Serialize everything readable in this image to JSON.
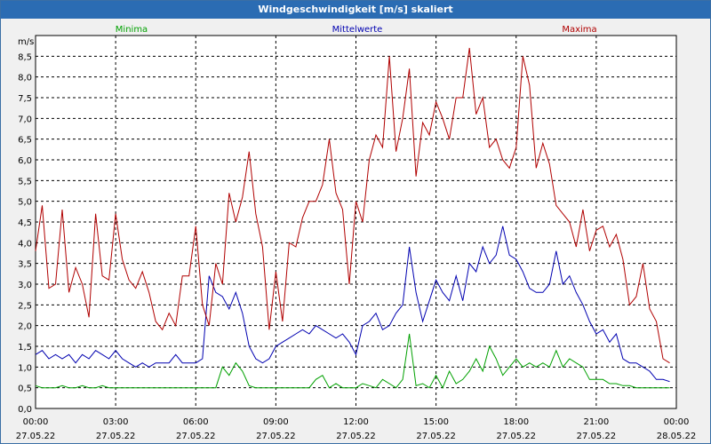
{
  "window": {
    "title": "Windgeschwindigkeit [m/s] skaliert"
  },
  "chart_data": {
    "type": "line",
    "ylabel": "m/s",
    "ylim": [
      0,
      9
    ],
    "xlim": [
      "27.05.22 00:00",
      "28.05.22 00:00"
    ],
    "grid": true,
    "legend_placement": "top",
    "y_ticks": [
      "0,0",
      "0,5",
      "1,0",
      "1,5",
      "2,0",
      "2,5",
      "3,0",
      "3,5",
      "4,0",
      "4,5",
      "5,0",
      "5,5",
      "6,0",
      "6,5",
      "7,0",
      "7,5",
      "8,0",
      "8,5"
    ],
    "x_ticks": [
      {
        "time": "00:00",
        "date": "27.05.22"
      },
      {
        "time": "03:00",
        "date": "27.05.22"
      },
      {
        "time": "06:00",
        "date": "27.05.22"
      },
      {
        "time": "09:00",
        "date": "27.05.22"
      },
      {
        "time": "12:00",
        "date": "27.05.22"
      },
      {
        "time": "15:00",
        "date": "27.05.22"
      },
      {
        "time": "18:00",
        "date": "27.05.22"
      },
      {
        "time": "21:00",
        "date": "27.05.22"
      },
      {
        "time": "00:00",
        "date": "28.05.22"
      }
    ],
    "x_hours": [
      0,
      0.25,
      0.5,
      0.75,
      1,
      1.25,
      1.5,
      1.75,
      2,
      2.25,
      2.5,
      2.75,
      3,
      3.25,
      3.5,
      3.75,
      4,
      4.25,
      4.5,
      4.75,
      5,
      5.25,
      5.5,
      5.75,
      6,
      6.25,
      6.5,
      6.75,
      7,
      7.25,
      7.5,
      7.75,
      8,
      8.25,
      8.5,
      8.75,
      9,
      9.25,
      9.5,
      9.75,
      10,
      10.25,
      10.5,
      10.75,
      11,
      11.25,
      11.5,
      11.75,
      12,
      12.25,
      12.5,
      12.75,
      13,
      13.25,
      13.5,
      13.75,
      14,
      14.25,
      14.5,
      14.75,
      15,
      15.25,
      15.5,
      15.75,
      16,
      16.25,
      16.5,
      16.75,
      17,
      17.25,
      17.5,
      17.75,
      18,
      18.25,
      18.5,
      18.75,
      19,
      19.25,
      19.5,
      19.75,
      20,
      20.25,
      20.5,
      20.75,
      21,
      21.25,
      21.5,
      21.75,
      22,
      22.25,
      22.5,
      22.75,
      23,
      23.25,
      23.5,
      23.75
    ],
    "series": [
      {
        "name": "Minima",
        "color": "#00a000",
        "values": [
          0.55,
          0.5,
          0.5,
          0.5,
          0.55,
          0.5,
          0.5,
          0.55,
          0.5,
          0.5,
          0.55,
          0.5,
          0.5,
          0.5,
          0.5,
          0.5,
          0.5,
          0.5,
          0.5,
          0.5,
          0.5,
          0.5,
          0.5,
          0.5,
          0.5,
          0.5,
          0.5,
          0.5,
          1.0,
          0.8,
          1.1,
          0.9,
          0.55,
          0.5,
          0.5,
          0.5,
          0.5,
          0.5,
          0.5,
          0.5,
          0.5,
          0.5,
          0.7,
          0.8,
          0.5,
          0.6,
          0.5,
          0.5,
          0.5,
          0.6,
          0.55,
          0.5,
          0.7,
          0.6,
          0.5,
          0.7,
          1.8,
          0.55,
          0.6,
          0.5,
          0.8,
          0.5,
          0.9,
          0.6,
          0.7,
          0.9,
          1.2,
          0.9,
          1.5,
          1.2,
          0.8,
          1.0,
          1.2,
          1.0,
          1.1,
          1.0,
          1.1,
          1.0,
          1.4,
          1.0,
          1.2,
          1.1,
          1.0,
          0.7,
          0.7,
          0.7,
          0.6,
          0.6,
          0.55,
          0.55,
          0.5,
          0.5,
          0.5,
          0.5,
          0.5,
          0.5
        ]
      },
      {
        "name": "Mittelwerte",
        "color": "#0000b0",
        "values": [
          1.3,
          1.4,
          1.2,
          1.3,
          1.2,
          1.3,
          1.1,
          1.3,
          1.2,
          1.4,
          1.3,
          1.2,
          1.4,
          1.2,
          1.1,
          1.0,
          1.1,
          1.0,
          1.1,
          1.1,
          1.1,
          1.3,
          1.1,
          1.1,
          1.1,
          1.2,
          3.2,
          2.8,
          2.7,
          2.4,
          2.8,
          2.3,
          1.5,
          1.2,
          1.1,
          1.2,
          1.5,
          1.6,
          1.7,
          1.8,
          1.9,
          1.8,
          2.0,
          1.9,
          1.8,
          1.7,
          1.8,
          1.6,
          1.3,
          2.0,
          2.1,
          2.3,
          1.9,
          2.0,
          2.3,
          2.5,
          3.9,
          2.8,
          2.1,
          2.6,
          3.1,
          2.8,
          2.6,
          3.2,
          2.6,
          3.5,
          3.3,
          3.9,
          3.5,
          3.7,
          4.4,
          3.7,
          3.6,
          3.3,
          2.9,
          2.8,
          2.8,
          3.0,
          3.8,
          3.0,
          3.2,
          2.8,
          2.5,
          2.1,
          1.8,
          1.9,
          1.6,
          1.8,
          1.2,
          1.1,
          1.1,
          1.0,
          0.9,
          0.7,
          0.7,
          0.65
        ]
      },
      {
        "name": "Maxima",
        "color": "#b00000",
        "values": [
          3.8,
          4.9,
          2.9,
          3.0,
          4.8,
          2.8,
          3.4,
          3.0,
          2.2,
          4.7,
          3.2,
          3.1,
          4.7,
          3.6,
          3.1,
          2.9,
          3.3,
          2.8,
          2.1,
          1.9,
          2.3,
          2.0,
          3.2,
          3.2,
          4.4,
          2.5,
          2.0,
          3.5,
          3.0,
          5.2,
          4.5,
          5.1,
          6.2,
          4.7,
          3.9,
          1.9,
          3.3,
          2.1,
          4.0,
          3.9,
          4.6,
          5.0,
          5.0,
          5.4,
          6.5,
          5.2,
          4.8,
          3.0,
          5.0,
          4.5,
          6.0,
          6.6,
          6.3,
          8.5,
          6.2,
          7.0,
          8.2,
          5.6,
          6.9,
          6.6,
          7.4,
          7.0,
          6.5,
          7.5,
          7.5,
          8.7,
          7.1,
          7.5,
          6.3,
          6.5,
          6.0,
          5.8,
          6.3,
          8.5,
          7.8,
          5.8,
          6.4,
          5.9,
          4.9,
          4.7,
          4.5,
          3.9,
          4.8,
          3.8,
          4.3,
          4.4,
          3.9,
          4.2,
          3.6,
          2.5,
          2.7,
          3.5,
          2.4,
          2.1,
          1.2,
          1.1
        ]
      }
    ]
  }
}
